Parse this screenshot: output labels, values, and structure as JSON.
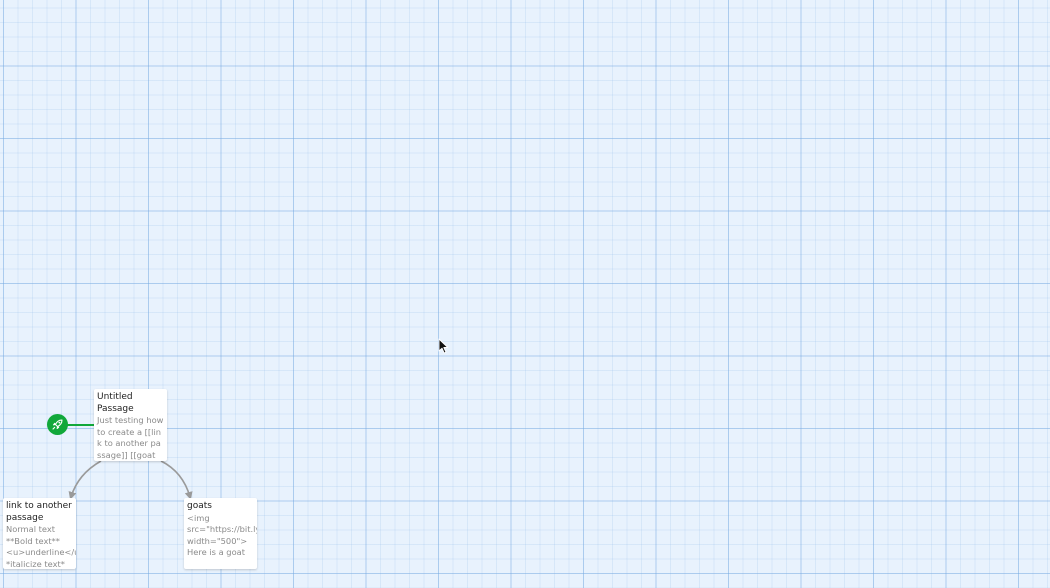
{
  "story_map": {
    "passages": [
      {
        "id": "untitled",
        "title": "Untitled Passage",
        "excerpt": "Just testing how to create a [[link to another passage]] [[goats]]"
      },
      {
        "id": "link",
        "title": "link to another passage",
        "excerpt": "Normal text\n**Bold text**\n<u>underline</u>\n*italicize text*"
      },
      {
        "id": "goats",
        "title": "goats",
        "excerpt": "<img\nsrc=\"https://bit.ly\nwidth=\"500\">\nHere is a goat"
      }
    ],
    "start_icon": "rocket-icon",
    "colors": {
      "background": "#e8f2fd",
      "start": "#11a83a",
      "link_arrow": "#9a9a9a",
      "card": "#ffffff"
    }
  }
}
